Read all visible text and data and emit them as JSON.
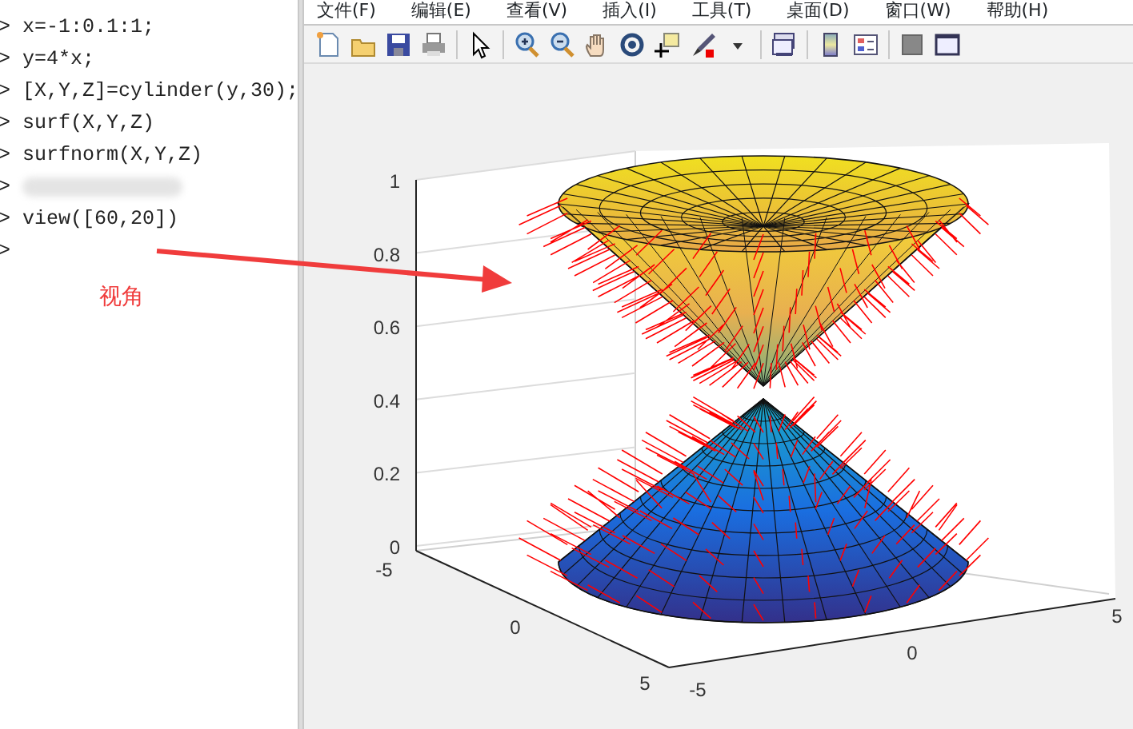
{
  "command_window": {
    "lines": [
      {
        "prompt": ">",
        "command": "x=-1:0.1:1;",
        "blurred": false
      },
      {
        "prompt": ">",
        "command": "y=4*x;",
        "blurred": false
      },
      {
        "prompt": ">",
        "command": "[X,Y,Z]=cylinder(y,30);",
        "blurred": false
      },
      {
        "prompt": ">",
        "command": "surf(X,Y,Z)",
        "blurred": false
      },
      {
        "prompt": ">",
        "command": "surfnorm(X,Y,Z)",
        "blurred": false
      },
      {
        "prompt": ">",
        "blurred": true
      },
      {
        "prompt": ">",
        "command": "view([60,20])",
        "blurred": false
      },
      {
        "prompt": ">",
        "blurred": false
      }
    ]
  },
  "annotation": {
    "text": "视角"
  },
  "figure": {
    "menu": [
      "文件(F)",
      "编辑(E)",
      "查看(V)",
      "插入(I)",
      "工具(T)",
      "桌面(D)",
      "窗口(W)",
      "帮助(H)"
    ],
    "axes": {
      "z_ticks": [
        "1",
        "0.8",
        "0.6",
        "0.4",
        "0.2",
        "0"
      ],
      "x_ticks": [
        "-5",
        "0",
        "5"
      ],
      "y_ticks": [
        "-5",
        "0",
        "5"
      ]
    }
  }
}
